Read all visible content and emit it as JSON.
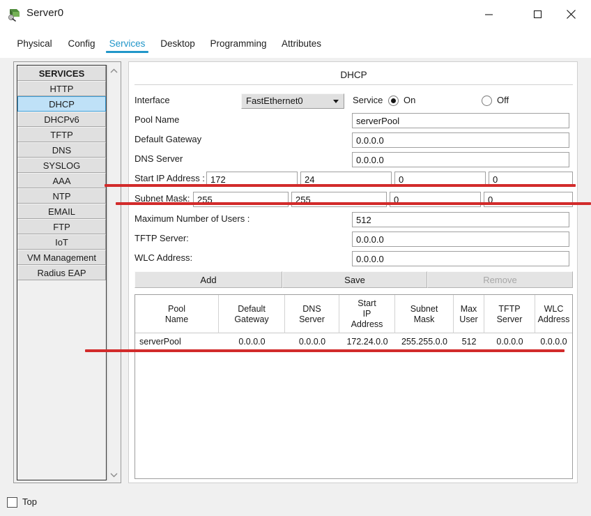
{
  "window": {
    "title": "Server0",
    "icon": "server-device-icon",
    "controls": {
      "minimize": "minimize-icon",
      "maximize": "maximize-icon",
      "close": "close-icon"
    }
  },
  "tabs": [
    {
      "id": "physical",
      "label": "Physical",
      "active": false
    },
    {
      "id": "config",
      "label": "Config",
      "active": false
    },
    {
      "id": "services",
      "label": "Services",
      "active": true
    },
    {
      "id": "desktop",
      "label": "Desktop",
      "active": false
    },
    {
      "id": "programming",
      "label": "Programming",
      "active": false
    },
    {
      "id": "attributes",
      "label": "Attributes",
      "active": false
    }
  ],
  "sidebar": {
    "header": "SERVICES",
    "items": [
      {
        "label": "HTTP",
        "selected": false
      },
      {
        "label": "DHCP",
        "selected": true
      },
      {
        "label": "DHCPv6",
        "selected": false
      },
      {
        "label": "TFTP",
        "selected": false
      },
      {
        "label": "DNS",
        "selected": false
      },
      {
        "label": "SYSLOG",
        "selected": false
      },
      {
        "label": "AAA",
        "selected": false
      },
      {
        "label": "NTP",
        "selected": false
      },
      {
        "label": "EMAIL",
        "selected": false
      },
      {
        "label": "FTP",
        "selected": false
      },
      {
        "label": "IoT",
        "selected": false
      },
      {
        "label": "VM Management",
        "selected": false
      },
      {
        "label": "Radius EAP",
        "selected": false
      }
    ],
    "scroll_up": "chevron-up-icon",
    "scroll_down": "chevron-down-icon"
  },
  "main": {
    "title": "DHCP",
    "interface": {
      "label": "Interface",
      "value": "FastEthernet0",
      "options": [
        "FastEthernet0"
      ]
    },
    "service": {
      "label": "Service",
      "on_label": "On",
      "off_label": "Off",
      "value": "On"
    },
    "pool_name": {
      "label": "Pool Name",
      "value": "serverPool"
    },
    "default_gateway": {
      "label": "Default Gateway",
      "value": "0.0.0.0"
    },
    "dns_server": {
      "label": "DNS Server",
      "value": "0.0.0.0"
    },
    "start_ip": {
      "label": "Start IP Address :",
      "octets": [
        "172",
        "24",
        "0",
        "0"
      ]
    },
    "subnet_mask": {
      "label": "Subnet Mask:",
      "octets": [
        "255",
        "255",
        "0",
        "0"
      ]
    },
    "max_users": {
      "label": "Maximum Number of Users :",
      "value": "512"
    },
    "tftp_server": {
      "label": "TFTP Server:",
      "value": "0.0.0.0"
    },
    "wlc_address": {
      "label": "WLC Address:",
      "value": "0.0.0.0"
    },
    "buttons": {
      "add": "Add",
      "save": "Save",
      "remove": "Remove",
      "remove_disabled": true
    },
    "table": {
      "columns": [
        "Pool\nName",
        "Default\nGateway",
        "DNS\nServer",
        "Start\nIP\nAddress",
        "Subnet\nMask",
        "Max\nUser",
        "TFTP\nServer",
        "WLC\nAddress"
      ],
      "rows": [
        [
          "serverPool",
          "0.0.0.0",
          "0.0.0.0",
          "172.24.0.0",
          "255.255.0.0",
          "512",
          "0.0.0.0",
          "0.0.0.0"
        ]
      ]
    }
  },
  "bottom": {
    "top_checkbox": {
      "label": "Top",
      "checked": false
    }
  },
  "annotations": {
    "color": "#d22b2b",
    "lines": [
      {
        "name": "subnet-mask-row-highlight-top"
      },
      {
        "name": "subnet-mask-row-highlight-bottom"
      },
      {
        "name": "table-row-highlight"
      }
    ]
  },
  "colors": {
    "accent": "#2196c9",
    "selection": "#bfe1f7",
    "annotation": "#d22b2b"
  }
}
